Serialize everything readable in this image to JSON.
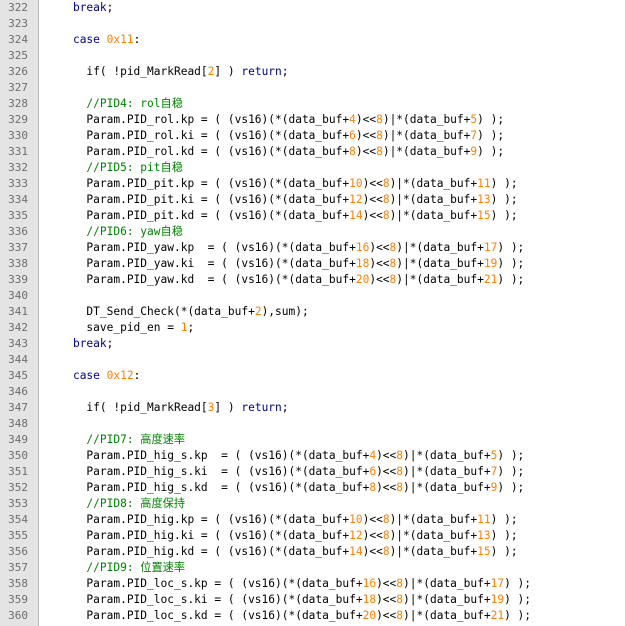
{
  "editor": {
    "lines": [
      {
        "n": "322",
        "tokens": [
          {
            "t": "    ",
            "c": "pl"
          },
          {
            "t": "break",
            "c": "kw"
          },
          {
            "t": ";",
            "c": "pl"
          }
        ]
      },
      {
        "n": "323",
        "tokens": []
      },
      {
        "n": "324",
        "tokens": [
          {
            "t": "    ",
            "c": "pl"
          },
          {
            "t": "case",
            "c": "kw"
          },
          {
            "t": " ",
            "c": "pl"
          },
          {
            "t": "0x11",
            "c": "num"
          },
          {
            "t": ":",
            "c": "pl"
          }
        ]
      },
      {
        "n": "325",
        "tokens": []
      },
      {
        "n": "326",
        "tokens": [
          {
            "t": "      if( !pid_MarkRead[",
            "c": "pl"
          },
          {
            "t": "2",
            "c": "num"
          },
          {
            "t": "] ) ",
            "c": "pl"
          },
          {
            "t": "return",
            "c": "kw"
          },
          {
            "t": ";",
            "c": "pl"
          }
        ]
      },
      {
        "n": "327",
        "tokens": []
      },
      {
        "n": "328",
        "tokens": [
          {
            "t": "      ",
            "c": "pl"
          },
          {
            "t": "//PID4: rol自稳",
            "c": "cm"
          }
        ]
      },
      {
        "n": "329",
        "tokens": [
          {
            "t": "      Param.PID_rol.kp = ( (vs16)(*(data_buf+",
            "c": "pl"
          },
          {
            "t": "4",
            "c": "num"
          },
          {
            "t": ")<<",
            "c": "pl"
          },
          {
            "t": "8",
            "c": "num"
          },
          {
            "t": ")|*(data_buf+",
            "c": "pl"
          },
          {
            "t": "5",
            "c": "num"
          },
          {
            "t": ") );",
            "c": "pl"
          }
        ]
      },
      {
        "n": "330",
        "tokens": [
          {
            "t": "      Param.PID_rol.ki = ( (vs16)(*(data_buf+",
            "c": "pl"
          },
          {
            "t": "6",
            "c": "num"
          },
          {
            "t": ")<<",
            "c": "pl"
          },
          {
            "t": "8",
            "c": "num"
          },
          {
            "t": ")|*(data_buf+",
            "c": "pl"
          },
          {
            "t": "7",
            "c": "num"
          },
          {
            "t": ") );",
            "c": "pl"
          }
        ]
      },
      {
        "n": "331",
        "tokens": [
          {
            "t": "      Param.PID_rol.kd = ( (vs16)(*(data_buf+",
            "c": "pl"
          },
          {
            "t": "8",
            "c": "num"
          },
          {
            "t": ")<<",
            "c": "pl"
          },
          {
            "t": "8",
            "c": "num"
          },
          {
            "t": ")|*(data_buf+",
            "c": "pl"
          },
          {
            "t": "9",
            "c": "num"
          },
          {
            "t": ") );",
            "c": "pl"
          }
        ]
      },
      {
        "n": "332",
        "tokens": [
          {
            "t": "      ",
            "c": "pl"
          },
          {
            "t": "//PID5: pit自稳",
            "c": "cm"
          }
        ]
      },
      {
        "n": "333",
        "tokens": [
          {
            "t": "      Param.PID_pit.kp = ( (vs16)(*(data_buf+",
            "c": "pl"
          },
          {
            "t": "10",
            "c": "num"
          },
          {
            "t": ")<<",
            "c": "pl"
          },
          {
            "t": "8",
            "c": "num"
          },
          {
            "t": ")|*(data_buf+",
            "c": "pl"
          },
          {
            "t": "11",
            "c": "num"
          },
          {
            "t": ") );",
            "c": "pl"
          }
        ]
      },
      {
        "n": "334",
        "tokens": [
          {
            "t": "      Param.PID_pit.ki = ( (vs16)(*(data_buf+",
            "c": "pl"
          },
          {
            "t": "12",
            "c": "num"
          },
          {
            "t": ")<<",
            "c": "pl"
          },
          {
            "t": "8",
            "c": "num"
          },
          {
            "t": ")|*(data_buf+",
            "c": "pl"
          },
          {
            "t": "13",
            "c": "num"
          },
          {
            "t": ") );",
            "c": "pl"
          }
        ]
      },
      {
        "n": "335",
        "tokens": [
          {
            "t": "      Param.PID_pit.kd = ( (vs16)(*(data_buf+",
            "c": "pl"
          },
          {
            "t": "14",
            "c": "num"
          },
          {
            "t": ")<<",
            "c": "pl"
          },
          {
            "t": "8",
            "c": "num"
          },
          {
            "t": ")|*(data_buf+",
            "c": "pl"
          },
          {
            "t": "15",
            "c": "num"
          },
          {
            "t": ") );",
            "c": "pl"
          }
        ]
      },
      {
        "n": "336",
        "tokens": [
          {
            "t": "      ",
            "c": "pl"
          },
          {
            "t": "//PID6: yaw自稳",
            "c": "cm"
          }
        ]
      },
      {
        "n": "337",
        "tokens": [
          {
            "t": "      Param.PID_yaw.kp  = ( (vs16)(*(data_buf+",
            "c": "pl"
          },
          {
            "t": "16",
            "c": "num"
          },
          {
            "t": ")<<",
            "c": "pl"
          },
          {
            "t": "8",
            "c": "num"
          },
          {
            "t": ")|*(data_buf+",
            "c": "pl"
          },
          {
            "t": "17",
            "c": "num"
          },
          {
            "t": ") );",
            "c": "pl"
          }
        ]
      },
      {
        "n": "338",
        "tokens": [
          {
            "t": "      Param.PID_yaw.ki  = ( (vs16)(*(data_buf+",
            "c": "pl"
          },
          {
            "t": "18",
            "c": "num"
          },
          {
            "t": ")<<",
            "c": "pl"
          },
          {
            "t": "8",
            "c": "num"
          },
          {
            "t": ")|*(data_buf+",
            "c": "pl"
          },
          {
            "t": "19",
            "c": "num"
          },
          {
            "t": ") );",
            "c": "pl"
          }
        ]
      },
      {
        "n": "339",
        "tokens": [
          {
            "t": "      Param.PID_yaw.kd  = ( (vs16)(*(data_buf+",
            "c": "pl"
          },
          {
            "t": "20",
            "c": "num"
          },
          {
            "t": ")<<",
            "c": "pl"
          },
          {
            "t": "8",
            "c": "num"
          },
          {
            "t": ")|*(data_buf+",
            "c": "pl"
          },
          {
            "t": "21",
            "c": "num"
          },
          {
            "t": ") );",
            "c": "pl"
          }
        ]
      },
      {
        "n": "340",
        "tokens": []
      },
      {
        "n": "341",
        "tokens": [
          {
            "t": "      DT_Send_Check(*(data_buf+",
            "c": "pl"
          },
          {
            "t": "2",
            "c": "num"
          },
          {
            "t": "),sum);",
            "c": "pl"
          }
        ]
      },
      {
        "n": "342",
        "tokens": [
          {
            "t": "      save_pid_en = ",
            "c": "pl"
          },
          {
            "t": "1",
            "c": "num"
          },
          {
            "t": ";",
            "c": "pl"
          }
        ]
      },
      {
        "n": "343",
        "tokens": [
          {
            "t": "    ",
            "c": "pl"
          },
          {
            "t": "break",
            "c": "kw"
          },
          {
            "t": ";",
            "c": "pl"
          }
        ]
      },
      {
        "n": "344",
        "tokens": []
      },
      {
        "n": "345",
        "tokens": [
          {
            "t": "    ",
            "c": "pl"
          },
          {
            "t": "case",
            "c": "kw"
          },
          {
            "t": " ",
            "c": "pl"
          },
          {
            "t": "0x12",
            "c": "num"
          },
          {
            "t": ":",
            "c": "pl"
          }
        ]
      },
      {
        "n": "346",
        "tokens": []
      },
      {
        "n": "347",
        "tokens": [
          {
            "t": "      if( !pid_MarkRead[",
            "c": "pl"
          },
          {
            "t": "3",
            "c": "num"
          },
          {
            "t": "] ) ",
            "c": "pl"
          },
          {
            "t": "return",
            "c": "kw"
          },
          {
            "t": ";",
            "c": "pl"
          }
        ]
      },
      {
        "n": "348",
        "tokens": []
      },
      {
        "n": "349",
        "tokens": [
          {
            "t": "      ",
            "c": "pl"
          },
          {
            "t": "//PID7: 高度速率",
            "c": "cm"
          }
        ]
      },
      {
        "n": "350",
        "tokens": [
          {
            "t": "      Param.PID_hig_s.kp  = ( (vs16)(*(data_buf+",
            "c": "pl"
          },
          {
            "t": "4",
            "c": "num"
          },
          {
            "t": ")<<",
            "c": "pl"
          },
          {
            "t": "8",
            "c": "num"
          },
          {
            "t": ")|*(data_buf+",
            "c": "pl"
          },
          {
            "t": "5",
            "c": "num"
          },
          {
            "t": ") );",
            "c": "pl"
          }
        ]
      },
      {
        "n": "351",
        "tokens": [
          {
            "t": "      Param.PID_hig_s.ki  = ( (vs16)(*(data_buf+",
            "c": "pl"
          },
          {
            "t": "6",
            "c": "num"
          },
          {
            "t": ")<<",
            "c": "pl"
          },
          {
            "t": "8",
            "c": "num"
          },
          {
            "t": ")|*(data_buf+",
            "c": "pl"
          },
          {
            "t": "7",
            "c": "num"
          },
          {
            "t": ") );",
            "c": "pl"
          }
        ]
      },
      {
        "n": "352",
        "tokens": [
          {
            "t": "      Param.PID_hig_s.kd  = ( (vs16)(*(data_buf+",
            "c": "pl"
          },
          {
            "t": "8",
            "c": "num"
          },
          {
            "t": ")<<",
            "c": "pl"
          },
          {
            "t": "8",
            "c": "num"
          },
          {
            "t": ")|*(data_buf+",
            "c": "pl"
          },
          {
            "t": "9",
            "c": "num"
          },
          {
            "t": ") );",
            "c": "pl"
          }
        ]
      },
      {
        "n": "353",
        "tokens": [
          {
            "t": "      ",
            "c": "pl"
          },
          {
            "t": "//PID8: 高度保持",
            "c": "cm"
          }
        ]
      },
      {
        "n": "354",
        "tokens": [
          {
            "t": "      Param.PID_hig.kp = ( (vs16)(*(data_buf+",
            "c": "pl"
          },
          {
            "t": "10",
            "c": "num"
          },
          {
            "t": ")<<",
            "c": "pl"
          },
          {
            "t": "8",
            "c": "num"
          },
          {
            "t": ")|*(data_buf+",
            "c": "pl"
          },
          {
            "t": "11",
            "c": "num"
          },
          {
            "t": ") );",
            "c": "pl"
          }
        ]
      },
      {
        "n": "355",
        "tokens": [
          {
            "t": "      Param.PID_hig.ki = ( (vs16)(*(data_buf+",
            "c": "pl"
          },
          {
            "t": "12",
            "c": "num"
          },
          {
            "t": ")<<",
            "c": "pl"
          },
          {
            "t": "8",
            "c": "num"
          },
          {
            "t": ")|*(data_buf+",
            "c": "pl"
          },
          {
            "t": "13",
            "c": "num"
          },
          {
            "t": ") );",
            "c": "pl"
          }
        ]
      },
      {
        "n": "356",
        "tokens": [
          {
            "t": "      Param.PID_hig.kd = ( (vs16)(*(data_buf+",
            "c": "pl"
          },
          {
            "t": "14",
            "c": "num"
          },
          {
            "t": ")<<",
            "c": "pl"
          },
          {
            "t": "8",
            "c": "num"
          },
          {
            "t": ")|*(data_buf+",
            "c": "pl"
          },
          {
            "t": "15",
            "c": "num"
          },
          {
            "t": ") );",
            "c": "pl"
          }
        ]
      },
      {
        "n": "357",
        "tokens": [
          {
            "t": "      ",
            "c": "pl"
          },
          {
            "t": "//PID9: 位置速率",
            "c": "cm"
          }
        ]
      },
      {
        "n": "358",
        "tokens": [
          {
            "t": "      Param.PID_loc_s.kp = ( (vs16)(*(data_buf+",
            "c": "pl"
          },
          {
            "t": "16",
            "c": "num"
          },
          {
            "t": ")<<",
            "c": "pl"
          },
          {
            "t": "8",
            "c": "num"
          },
          {
            "t": ")|*(data_buf+",
            "c": "pl"
          },
          {
            "t": "17",
            "c": "num"
          },
          {
            "t": ") );",
            "c": "pl"
          }
        ]
      },
      {
        "n": "359",
        "tokens": [
          {
            "t": "      Param.PID_loc_s.ki = ( (vs16)(*(data_buf+",
            "c": "pl"
          },
          {
            "t": "18",
            "c": "num"
          },
          {
            "t": ")<<",
            "c": "pl"
          },
          {
            "t": "8",
            "c": "num"
          },
          {
            "t": ")|*(data_buf+",
            "c": "pl"
          },
          {
            "t": "19",
            "c": "num"
          },
          {
            "t": ") );",
            "c": "pl"
          }
        ]
      },
      {
        "n": "360",
        "tokens": [
          {
            "t": "      Param.PID_loc_s.kd = ( (vs16)(*(data_buf+",
            "c": "pl"
          },
          {
            "t": "20",
            "c": "num"
          },
          {
            "t": ")<<",
            "c": "pl"
          },
          {
            "t": "8",
            "c": "num"
          },
          {
            "t": ")|*(data_buf+",
            "c": "pl"
          },
          {
            "t": "21",
            "c": "num"
          },
          {
            "t": ") );",
            "c": "pl"
          }
        ]
      }
    ]
  },
  "colors": {
    "keyword": "#00008b",
    "number": "#ff7f00",
    "comment": "#008000",
    "plain": "#000000",
    "gutter": "#e4e4e4",
    "line_number": "#6e6e6e"
  }
}
